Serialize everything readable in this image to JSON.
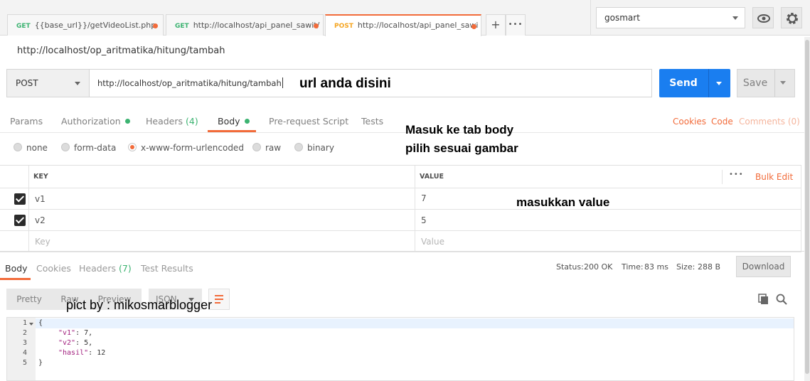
{
  "tabs": [
    {
      "method": "GET",
      "label": "{{base_url}}/getVideoList.php",
      "method_color": "#3cb371"
    },
    {
      "method": "GET",
      "label": "http://localhost/api_panel_sawit/",
      "method_color": "#3cb371"
    },
    {
      "method": "POST",
      "label": "http://localhost/api_panel_sawi",
      "method_color": "#f5a623"
    }
  ],
  "tab_add": "+",
  "tab_more": "•••",
  "environment": "gosmart",
  "request": {
    "title": "http://localhost/op_aritmatika/hitung/tambah",
    "method": "POST",
    "url": "http://localhost/op_aritmatika/hitung/tambah",
    "send_label": "Send",
    "save_label": "Save"
  },
  "request_tabs": {
    "params": "Params",
    "authorization": "Authorization",
    "headers": "Headers",
    "headers_count": "(4)",
    "body": "Body",
    "pre_request": "Pre-request Script",
    "tests": "Tests",
    "cookies": "Cookies",
    "code": "Code",
    "comments": "Comments (0)"
  },
  "body_types": [
    "none",
    "form-data",
    "x-www-form-urlencoded",
    "raw",
    "binary"
  ],
  "body_type_selected": "x-www-form-urlencoded",
  "table": {
    "key_header": "KEY",
    "value_header": "VALUE",
    "more": "•••",
    "bulk_edit": "Bulk Edit",
    "rows": [
      {
        "key": "v1",
        "value": "7",
        "checked": true
      },
      {
        "key": "v2",
        "value": "5",
        "checked": true
      }
    ],
    "placeholder_key": "Key",
    "placeholder_value": "Value"
  },
  "response": {
    "tabs": {
      "body": "Body",
      "cookies": "Cookies",
      "headers": "Headers",
      "headers_count": "(7)",
      "test_results": "Test Results"
    },
    "status_label": "Status:",
    "status": "200 OK",
    "time_label": "Time:",
    "time": "83 ms",
    "size_label": "Size:",
    "size": "288 B",
    "download": "Download",
    "format_buttons": {
      "pretty": "Pretty",
      "raw": "Raw",
      "preview": "Preview",
      "json": "JSON"
    },
    "code_lines": [
      {
        "n": "1",
        "text": "{"
      },
      {
        "n": "2",
        "key": "\"v1\"",
        "rest": ": 7,"
      },
      {
        "n": "3",
        "key": "\"v2\"",
        "rest": ": 5,"
      },
      {
        "n": "4",
        "key": "\"hasil\"",
        "rest": ": 12"
      },
      {
        "n": "5",
        "text": "}"
      }
    ]
  },
  "annotations": {
    "url_note": "url anda disini",
    "body_note_1": "Masuk ke tab body",
    "body_note_2": "pilih sesuai gambar",
    "value_note": "masukkan value",
    "credit": "pict by : mikosmarblogger"
  },
  "colors": {
    "accent": "#f26b3a",
    "send": "#1a7ef0",
    "success": "#3cb371"
  }
}
